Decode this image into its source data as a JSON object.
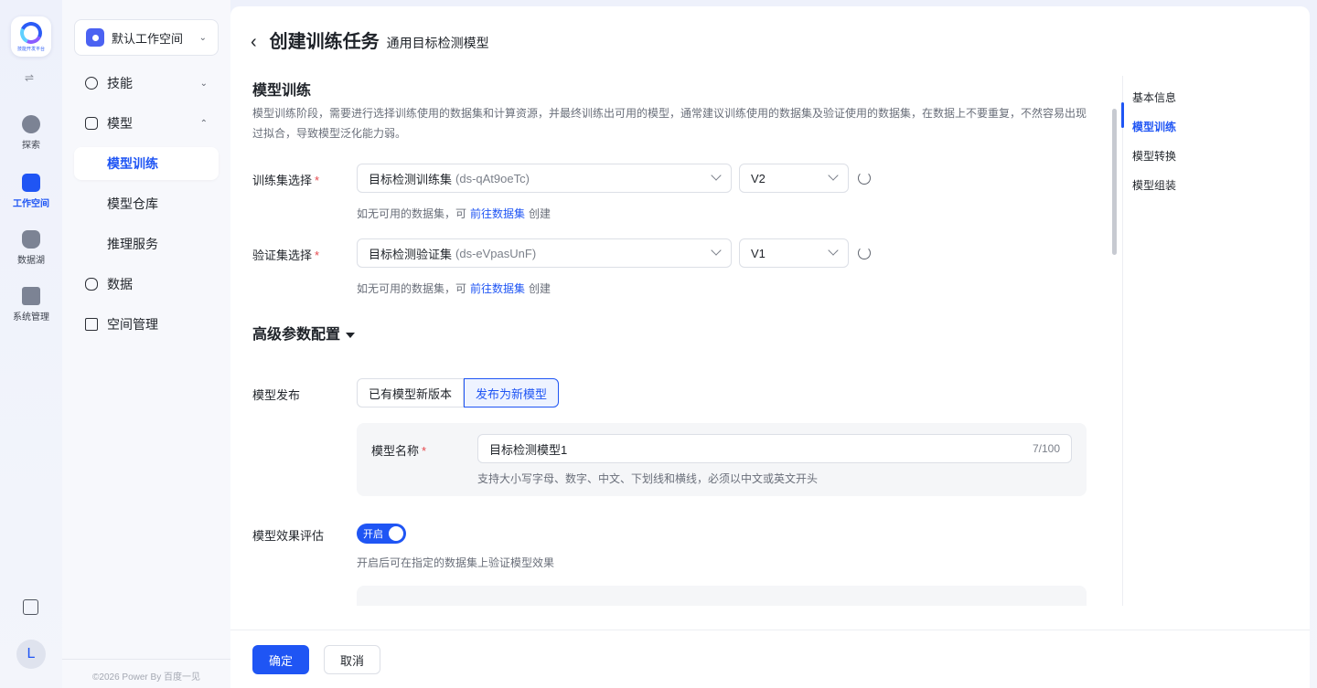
{
  "rail": {
    "logo_text": "技能开发平台",
    "items": [
      {
        "label": "探索",
        "icon": "planet-icon"
      },
      {
        "label": "工作空间",
        "icon": "terminal-folder-icon"
      },
      {
        "label": "数据湖",
        "icon": "database-icon"
      },
      {
        "label": "系统管理",
        "icon": "server-icon"
      }
    ],
    "avatar_letter": "L"
  },
  "menu": {
    "workspace": "默认工作空间",
    "items": [
      {
        "label": "技能",
        "icon": "cloud-icon"
      },
      {
        "label": "模型",
        "icon": "cube-icon"
      },
      {
        "label": "模型训练"
      },
      {
        "label": "模型仓库"
      },
      {
        "label": "推理服务"
      },
      {
        "label": "数据",
        "icon": "database-icon"
      },
      {
        "label": "空间管理",
        "icon": "book-icon"
      }
    ],
    "copyright": "©2026 Power By 百度一见"
  },
  "header": {
    "title": "创建训练任务",
    "subtitle": "通用目标检测模型"
  },
  "section": {
    "title": "模型训练",
    "desc": "模型训练阶段，需要进行选择训练使用的数据集和计算资源，并最终训练出可用的模型，通常建议训练使用的数据集及验证使用的数据集，在数据上不要重复，不然容易出现过拟合，导致模型泛化能力弱。"
  },
  "train_set": {
    "label": "训练集选择",
    "required": "*",
    "value": "目标检测训练集",
    "code": "(ds-qAt9oeTc)",
    "version": "V2"
  },
  "val_set": {
    "label": "验证集选择",
    "required": "*",
    "value": "目标检测验证集",
    "code": "(ds-eVpasUnF)",
    "version": "V1"
  },
  "hint": {
    "prefix": "如无可用的数据集，可",
    "link": "前往数据集",
    "suffix": "创建"
  },
  "advanced": {
    "title": "高级参数配置"
  },
  "publish": {
    "label": "模型发布",
    "options": [
      "已有模型新版本",
      "发布为新模型"
    ],
    "selected": "发布为新模型"
  },
  "model_name": {
    "label": "模型名称",
    "required": "*",
    "value": "目标检测模型1",
    "count": "7/100",
    "hint": "支持大小写字母、数字、中文、下划线和横线，必须以中文或英文开头"
  },
  "evaluation": {
    "label": "模型效果评估",
    "switch_label": "开启",
    "enabled": true,
    "hint": "开启后可在指定的数据集上验证模型效果"
  },
  "anchors": [
    "基本信息",
    "模型训练",
    "模型转换",
    "模型组装"
  ],
  "footer": {
    "confirm": "确定",
    "cancel": "取消"
  }
}
